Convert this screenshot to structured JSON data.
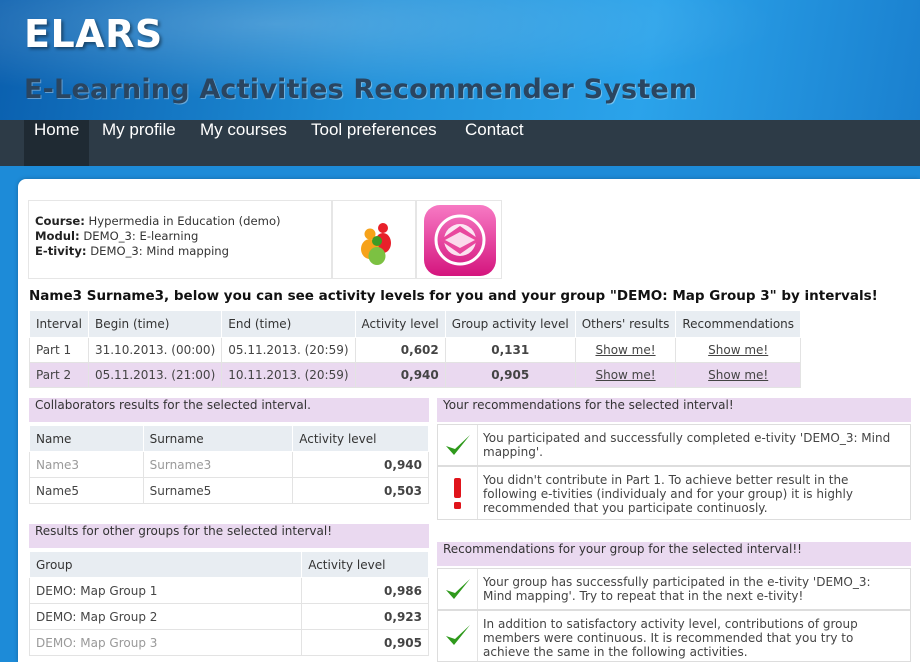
{
  "header": {
    "logo": "ELARS",
    "subtitle": "E-Learning Activities Recommender System"
  },
  "nav": {
    "items": [
      {
        "label": "Home",
        "active": true
      },
      {
        "label": "My profile",
        "active": false
      },
      {
        "label": "My courses",
        "active": false
      },
      {
        "label": "Tool preferences",
        "active": false
      },
      {
        "label": "Contact",
        "active": false
      }
    ]
  },
  "course_info": {
    "course_label": "Course:",
    "course_value": "Hypermedia in Education (demo)",
    "modul_label": "Modul:",
    "modul_value": "DEMO_3: E-learning",
    "etivity_label": "E-tivity:",
    "etivity_value": "DEMO_3: Mind mapping",
    "icons": [
      "group-people-icon",
      "mind-map-tool-icon"
    ]
  },
  "summary_heading": "Name3 Surname3, below you can see activity levels for you and your group \"DEMO: Map Group 3\" by intervals!",
  "interval_table": {
    "headers": [
      "Interval",
      "Begin (time)",
      "End (time)",
      "Activity level",
      "Group activity level",
      "Others' results",
      "Recommendations"
    ],
    "rows": [
      {
        "interval": "Part 1",
        "begin": "31.10.2013. (00:00)",
        "end": "05.11.2013. (20:59)",
        "activity": "0,602",
        "group_activity": "0,131",
        "others": "Show me!",
        "recommendations": "Show me!"
      },
      {
        "interval": "Part 2",
        "begin": "05.11.2013. (21:00)",
        "end": "10.11.2013. (20:59)",
        "activity": "0,940",
        "group_activity": "0,905",
        "others": "Show me!",
        "recommendations": "Show me!"
      }
    ]
  },
  "collaborators": {
    "title": "Collaborators results for the selected interval.",
    "headers": [
      "Name",
      "Surname",
      "Activity level"
    ],
    "rows": [
      {
        "name": "Name3",
        "surname": "Surname3",
        "activity": "0,940"
      },
      {
        "name": "Name5",
        "surname": "Surname5",
        "activity": "0,503"
      }
    ]
  },
  "other_groups": {
    "title": "Results for other groups for the selected interval!",
    "headers": [
      "Group",
      "Activity level"
    ],
    "rows": [
      {
        "group": "DEMO: Map Group 1",
        "activity": "0,986"
      },
      {
        "group": "DEMO: Map Group 2",
        "activity": "0,923"
      },
      {
        "group": "DEMO: Map Group 3",
        "activity": "0,905"
      }
    ]
  },
  "your_recommendations": {
    "title": "Your recommendations for the selected interval!",
    "items": [
      {
        "icon": "checkmark-icon",
        "text": "You participated and successfully completed e-tivity 'DEMO_3: Mind mapping'."
      },
      {
        "icon": "exclamation-icon",
        "text": "You didn't contribute in Part 1. To achieve better result in the following e-tivities (individualy and for your group) it is highly recommended that you participate continuosly."
      }
    ]
  },
  "group_recommendations": {
    "title": "Recommendations for your group for the selected interval!!",
    "items": [
      {
        "icon": "checkmark-icon",
        "text": "Your group has successfully participated in the e-tivity 'DEMO_3: Mind mapping'. Try to repeat that in the next e-tivity!"
      },
      {
        "icon": "checkmark-icon",
        "text": "In addition to satisfactory activity level, contributions of group members were continuous. It is recommended that you try to achieve the same in the following activities."
      }
    ]
  },
  "colors": {
    "header_blue": "#1f8fd8",
    "nav_dark": "#2d3b47",
    "highlight_row": "#ead9f0",
    "value_green": "#2a8a17",
    "value_red": "#d8141b",
    "link_blue": "#1a3fc4"
  }
}
